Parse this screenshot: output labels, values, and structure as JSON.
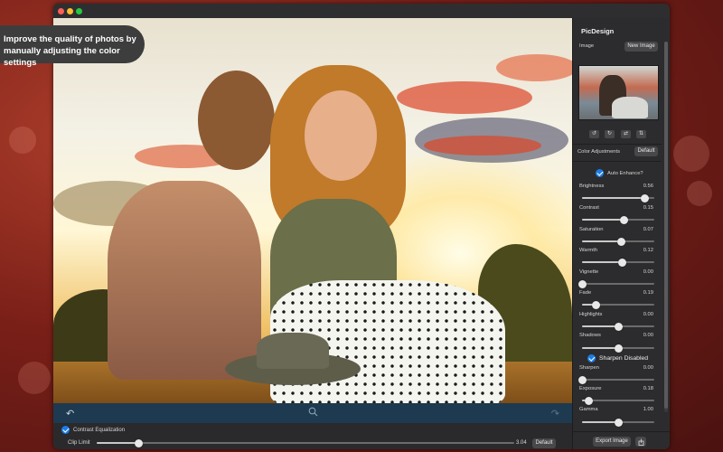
{
  "caption": {
    "line1": "Improve the quality of photos by",
    "line2": "manually adjusting the color settings"
  },
  "colors": {
    "accent": "#1a7ce6",
    "sidebar_bg": "#2c2c2e",
    "photo_toolbar_bg": "#1d3a50"
  },
  "photo_toolbar": {
    "undo_icon": "undo-arrow-icon",
    "zoom_icon": "magnifier-icon",
    "redo_icon": "redo-arrow-icon"
  },
  "bottom_bar": {
    "contrast_equalization_label": "Contrast Equalization",
    "contrast_equalization_checked": true,
    "clip_limit_label": "Clip Limit",
    "clip_limit_value": "3.04",
    "clip_limit_fraction": 0.1,
    "default_button": "Default"
  },
  "sidebar": {
    "app_title": "PicDesign",
    "image_label": "Image",
    "new_image_button": "New Image",
    "transform_icons": [
      "rotate-left-icon",
      "rotate-right-icon",
      "flip-horizontal-icon",
      "flip-vertical-icon"
    ],
    "transform_glyphs": [
      "↺",
      "↻",
      "⇄",
      "⇅"
    ],
    "color_adjustments_label": "Color Adjustments",
    "default_button": "Default",
    "auto_enhance_label": "Auto Enhance?",
    "auto_enhance_checked": true,
    "sharpen_label": "Sharpen Disabled",
    "sharpen_checked": true,
    "export_button": "Export Image",
    "share_icon": "share-icon",
    "sliders": [
      {
        "name": "Brightness",
        "value": "0.56",
        "fraction": 0.87
      },
      {
        "name": "Contrast",
        "value": "0.15",
        "fraction": 0.58
      },
      {
        "name": "Saturation",
        "value": "0.07",
        "fraction": 0.54
      },
      {
        "name": "Warmth",
        "value": "0.12",
        "fraction": 0.56
      },
      {
        "name": "Vignette",
        "value": "0.00",
        "fraction": 0.0
      },
      {
        "name": "Fade",
        "value": "0.19",
        "fraction": 0.19
      },
      {
        "name": "Highlights",
        "value": "0.00",
        "fraction": 0.5
      },
      {
        "name": "Shadows",
        "value": "0.00",
        "fraction": 0.5
      },
      {
        "name": "Sharpen",
        "value": "0.00",
        "fraction": 0.0
      },
      {
        "name": "Exposure",
        "value": "0.18",
        "fraction": 0.09
      },
      {
        "name": "Gamma",
        "value": "1.00",
        "fraction": 0.5
      }
    ]
  }
}
